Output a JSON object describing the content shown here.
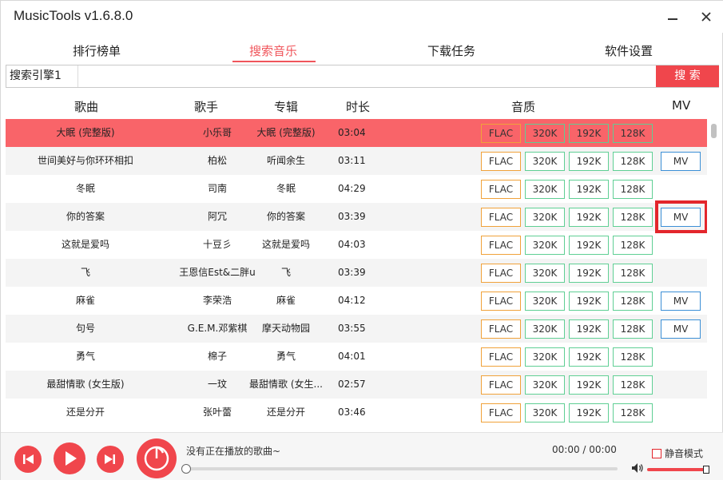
{
  "app": {
    "title": "MusicTools v1.6.8.0"
  },
  "tabs": [
    {
      "label": "排行榜单"
    },
    {
      "label": "搜索音乐"
    },
    {
      "label": "下载任务"
    },
    {
      "label": "软件设置"
    }
  ],
  "search": {
    "engine": "搜索引擎1",
    "value": "",
    "button": "搜 索"
  },
  "columns": {
    "song": "歌曲",
    "artist": "歌手",
    "album": "专辑",
    "duration": "时长",
    "quality": "音质",
    "mv": "MV"
  },
  "quality_labels": {
    "flac": "FLAC",
    "q320": "320K",
    "q192": "192K",
    "q128": "128K"
  },
  "mv_label": "MV",
  "rows": [
    {
      "song": "大眠 (完整版)",
      "artist": "小乐哥",
      "album": "大眠 (完整版)",
      "duration": "03:04",
      "mv": false,
      "selected": true
    },
    {
      "song": "世间美好与你环环相扣",
      "artist": "柏松",
      "album": "听闻余生",
      "duration": "03:11",
      "mv": true
    },
    {
      "song": "冬眠",
      "artist": "司南",
      "album": "冬眠",
      "duration": "04:29",
      "mv": false
    },
    {
      "song": "你的答案",
      "artist": "阿冗",
      "album": "你的答案",
      "duration": "03:39",
      "mv": true,
      "highlighted": true
    },
    {
      "song": "这就是爱吗",
      "artist": "十豆彡",
      "album": "这就是爱吗",
      "duration": "04:03",
      "mv": false
    },
    {
      "song": "飞",
      "artist": "王恩信Est&二胖u",
      "album": "飞",
      "duration": "03:39",
      "mv": false
    },
    {
      "song": "麻雀",
      "artist": "李荣浩",
      "album": "麻雀",
      "duration": "04:12",
      "mv": true
    },
    {
      "song": "句号",
      "artist": "G.E.M.邓紫棋",
      "album": "摩天动物园",
      "duration": "03:55",
      "mv": true
    },
    {
      "song": "勇气",
      "artist": "棉子",
      "album": "勇气",
      "duration": "04:01",
      "mv": false
    },
    {
      "song": "最甜情歌 (女生版)",
      "artist": "一玟",
      "album": "最甜情歌 (女生...",
      "duration": "02:57",
      "mv": false
    },
    {
      "song": "还是分开",
      "artist": "张叶蕾",
      "album": "还是分开",
      "duration": "03:46",
      "mv": false
    }
  ],
  "player": {
    "now_playing": "没有正在播放的歌曲~",
    "time": "00:00 / 00:00",
    "mute_label": "静音模式",
    "progress": 0,
    "volume": 1.0
  },
  "colors": {
    "accent": "#f0464c",
    "selected_row": "#f96469",
    "flac_border": "#f0a23a",
    "bitrate_border": "#5fcf94",
    "mv_border": "#3c8fd6"
  }
}
